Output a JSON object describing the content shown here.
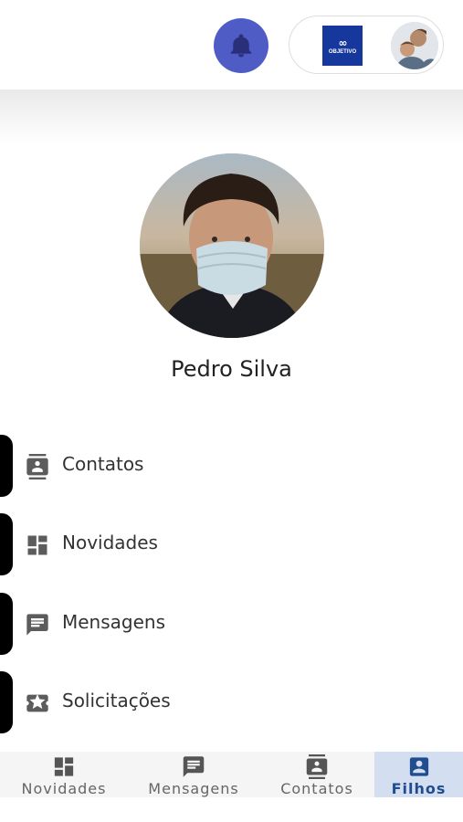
{
  "header": {
    "bell_icon": "bell-icon",
    "school": {
      "mark": "∞",
      "brand": "OBJETIVO"
    }
  },
  "profile": {
    "name": "Pedro Silva"
  },
  "menu": {
    "items": [
      {
        "label": "Contatos",
        "icon": "contacts-icon"
      },
      {
        "label": "Novidades",
        "icon": "dashboard-icon"
      },
      {
        "label": "Mensagens",
        "icon": "message-icon"
      },
      {
        "label": "Solicitações",
        "icon": "star-ticket-icon"
      }
    ]
  },
  "bottom_nav": {
    "items": [
      {
        "label": "Novidades",
        "icon": "dashboard-icon",
        "active": false
      },
      {
        "label": "Mensagens",
        "icon": "message-icon",
        "active": false
      },
      {
        "label": "Contatos",
        "icon": "contacts-icon",
        "active": false
      },
      {
        "label": "Filhos",
        "icon": "person-badge-icon",
        "active": true
      }
    ]
  },
  "colors": {
    "bell_bg": "#4f5cc6",
    "school_logo_bg": "#16379c",
    "active_nav_bg": "#d3dff0",
    "active_nav_text": "#1f4d8f"
  }
}
